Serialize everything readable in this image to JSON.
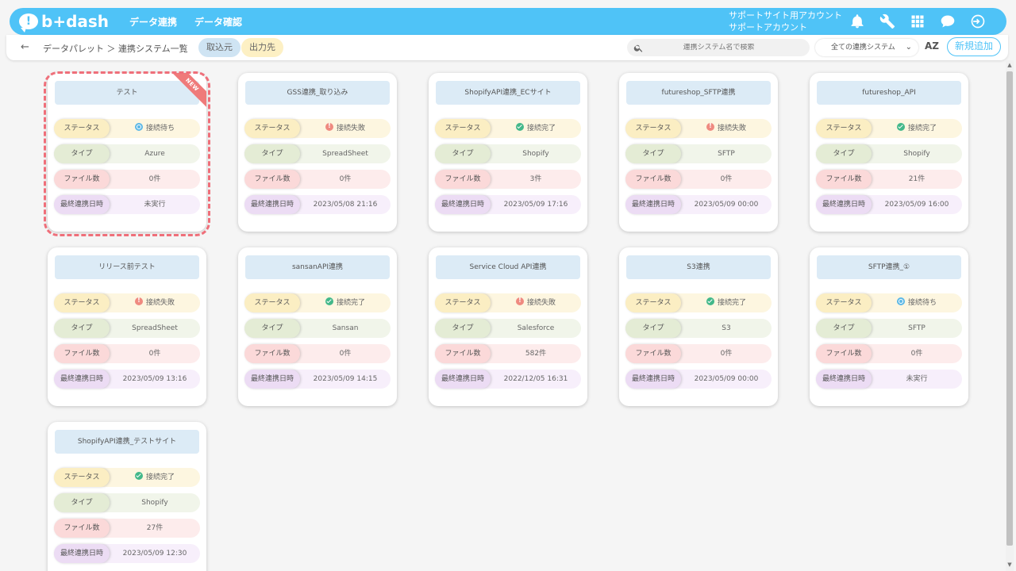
{
  "header": {
    "logo_text": "b+dash",
    "logo_mark": "!",
    "nav": [
      "データ連携",
      "データ確認"
    ],
    "account_line1": "サポートサイト用アカウント",
    "account_line2": "サポートアカウント",
    "icons": [
      "bell-icon",
      "wrench-icon",
      "grid-icon",
      "chat-icon",
      "logout-icon"
    ]
  },
  "subbar": {
    "back": "←",
    "breadcrumb": "データパレット ＞ 連携システム一覧",
    "tab_in": "取込元",
    "tab_out": "出力先",
    "search_placeholder": "連携システム名で検索",
    "filter_selected": "全ての連携システム",
    "sort_label": "AZ",
    "add_label": "新規追加"
  },
  "labels": {
    "status": "ステータス",
    "type": "タイプ",
    "files": "ファイル数",
    "last": "最終連携日時",
    "new_badge": "NEW"
  },
  "cards": [
    {
      "title": "テスト",
      "status": "接続待ち",
      "status_kind": "wait",
      "type": "Azure",
      "files": "0件",
      "last": "未実行",
      "is_new": true
    },
    {
      "title": "GSS連携_取り込み",
      "status": "接続失敗",
      "status_kind": "err",
      "type": "SpreadSheet",
      "files": "0件",
      "last": "2023/05/08 21:16"
    },
    {
      "title": "ShopifyAPI連携_ECサイト",
      "status": "接続完了",
      "status_kind": "ok",
      "type": "Shopify",
      "files": "3件",
      "last": "2023/05/09 17:16"
    },
    {
      "title": "futureshop_SFTP連携",
      "status": "接続失敗",
      "status_kind": "err",
      "type": "SFTP",
      "files": "0件",
      "last": "2023/05/09 00:00"
    },
    {
      "title": "futureshop_API",
      "status": "接続完了",
      "status_kind": "ok",
      "type": "Shopify",
      "files": "21件",
      "last": "2023/05/09 16:00"
    },
    {
      "title": "リリース前テスト",
      "status": "接続失敗",
      "status_kind": "err",
      "type": "SpreadSheet",
      "files": "0件",
      "last": "2023/05/09 13:16"
    },
    {
      "title": "sansanAPI連携",
      "status": "接続完了",
      "status_kind": "ok",
      "type": "Sansan",
      "files": "0件",
      "last": "2023/05/09 14:15"
    },
    {
      "title": "Service Cloud API連携",
      "status": "接続失敗",
      "status_kind": "err",
      "type": "Salesforce",
      "files": "582件",
      "last": "2022/12/05 16:31"
    },
    {
      "title": "S3連携",
      "status": "接続完了",
      "status_kind": "ok",
      "type": "S3",
      "files": "0件",
      "last": "2023/05/09 00:00"
    },
    {
      "title": "SFTP連携_①",
      "status": "接続待ち",
      "status_kind": "wait",
      "type": "SFTP",
      "files": "0件",
      "last": "未実行"
    },
    {
      "title": "ShopifyAPI連携_テストサイト",
      "status": "接続完了",
      "status_kind": "ok",
      "type": "Shopify",
      "files": "27件",
      "last": "2023/05/09 12:30"
    }
  ],
  "colors": {
    "accent": "#4fc3f7",
    "ok": "#43b88a",
    "err": "#ef8a80",
    "wait": "#5cb8e6",
    "highlight": "#ef6f7a"
  }
}
